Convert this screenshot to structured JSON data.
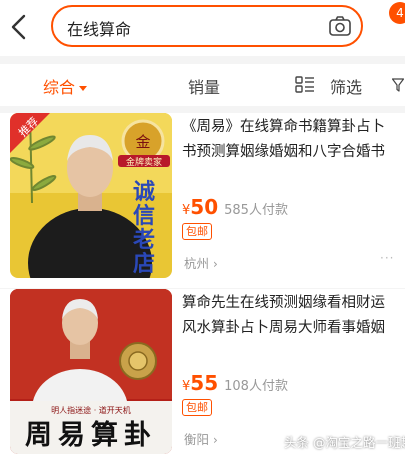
{
  "search": {
    "query": "在线算命",
    "notification_count": "4"
  },
  "filters": {
    "tabs": [
      {
        "label": "综合",
        "active": true
      },
      {
        "label": "销量",
        "active": false
      }
    ],
    "filter_label": "筛选"
  },
  "products": [
    {
      "title_line1": "《周易》在线算命书籍算卦占卜",
      "title_line2": "书预测算姻缘婚姻和八字合婚书",
      "currency": "¥",
      "price": "50",
      "sales": "585人付款",
      "shipping_tag": "包邮",
      "location": "杭州",
      "image_badge": "推荐",
      "image_seal_char": "金",
      "image_seal_text": "金牌卖家",
      "image_vertical_text": "诚信老店"
    },
    {
      "title_line1": "算命先生在线预测姻缘看相财运",
      "title_line2": "风水算卦占卜周易大师看事婚姻",
      "currency": "¥",
      "price": "55",
      "sales": "108人付款",
      "shipping_tag": "包邮",
      "location": "衡阳",
      "image_caption_small": "明人指迷途 · 道开天机",
      "image_caption_big": "周易算卦"
    }
  ],
  "watermark": "头条 @淘宝之路一班趟",
  "colors": {
    "accent": "#ff5000",
    "page_bg": "#f4f4f4"
  }
}
